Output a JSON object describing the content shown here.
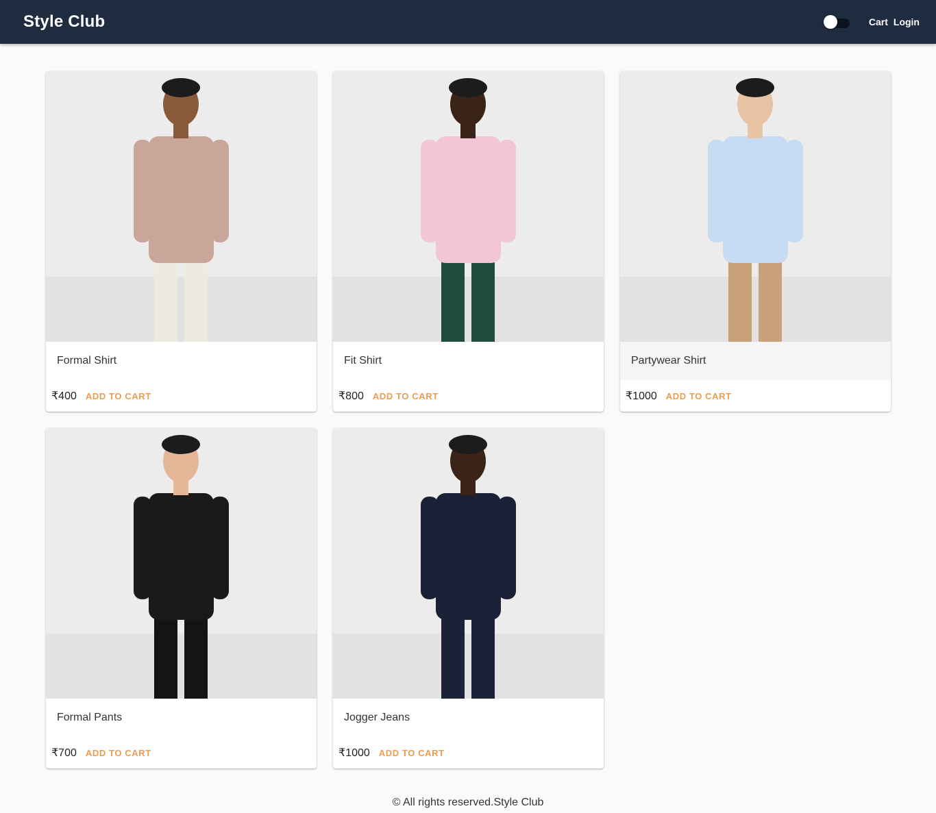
{
  "header": {
    "brand": "Style Club",
    "cart_label": "Cart",
    "login_label": "Login",
    "theme_toggle_on": false
  },
  "products": [
    {
      "name": "Formal Shirt",
      "price": "₹400",
      "action": "ADD TO CART",
      "shirt": "#c9a59a",
      "pants": "#efeadf",
      "skin": "#8a5a3c"
    },
    {
      "name": "Fit Shirt",
      "price": "₹800",
      "action": "ADD TO CART",
      "shirt": "#f2c6d4",
      "pants": "#1e4d3f",
      "skin": "#3a2418"
    },
    {
      "name": "Partywear Shirt",
      "price": "₹1000",
      "action": "ADD TO CART",
      "shirt": "#c7dcf3",
      "pants": "#c9a27a",
      "skin": "#e8c3a4"
    },
    {
      "name": "Formal Pants",
      "price": "₹700",
      "action": "ADD TO CART",
      "shirt": "#1a1a1a",
      "pants": "#141414",
      "skin": "#e4b896"
    },
    {
      "name": "Jogger Jeans",
      "price": "₹1000",
      "action": "ADD TO CART",
      "shirt": "#1b2238",
      "pants": "#1b2238",
      "skin": "#3a2418"
    }
  ],
  "footer": {
    "text": "© All rights reserved.Style Club"
  },
  "colors": {
    "appbar": "#1f2b3e",
    "accent": "#ec9b4f",
    "background": "#fafafa"
  }
}
